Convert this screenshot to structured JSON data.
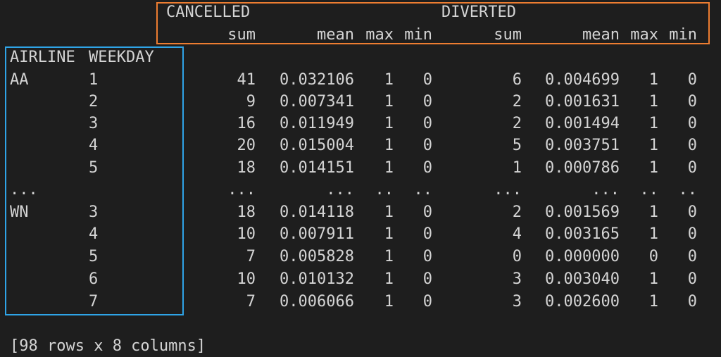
{
  "header": {
    "group_cancelled": "CANCELLED",
    "group_diverted": "DIVERTED",
    "columns": [
      "sum",
      "mean",
      "max",
      "min",
      "sum",
      "mean",
      "max",
      "min"
    ]
  },
  "index": {
    "names": [
      "AIRLINE",
      "WEEKDAY"
    ]
  },
  "rows": [
    [
      "AA",
      "1",
      "41",
      "0.032106",
      "1",
      "0",
      "6",
      "0.004699",
      "1",
      "0"
    ],
    [
      "",
      "2",
      "9",
      "0.007341",
      "1",
      "0",
      "2",
      "0.001631",
      "1",
      "0"
    ],
    [
      "",
      "3",
      "16",
      "0.011949",
      "1",
      "0",
      "2",
      "0.001494",
      "1",
      "0"
    ],
    [
      "",
      "4",
      "20",
      "0.015004",
      "1",
      "0",
      "5",
      "0.003751",
      "1",
      "0"
    ],
    [
      "",
      "5",
      "18",
      "0.014151",
      "1",
      "0",
      "1",
      "0.000786",
      "1",
      "0"
    ],
    [
      "...",
      "",
      "...",
      "...",
      "..",
      "..",
      "...",
      "...",
      "..",
      ".."
    ],
    [
      "WN",
      "3",
      "18",
      "0.014118",
      "1",
      "0",
      "2",
      "0.001569",
      "1",
      "0"
    ],
    [
      "",
      "4",
      "10",
      "0.007911",
      "1",
      "0",
      "4",
      "0.003165",
      "1",
      "0"
    ],
    [
      "",
      "5",
      "7",
      "0.005828",
      "1",
      "0",
      "0",
      "0.000000",
      "0",
      "0"
    ],
    [
      "",
      "6",
      "10",
      "0.010132",
      "1",
      "0",
      "3",
      "0.003040",
      "1",
      "0"
    ],
    [
      "",
      "7",
      "7",
      "0.006066",
      "1",
      "0",
      "3",
      "0.002600",
      "1",
      "0"
    ]
  ],
  "footer": "[98 rows x 8 columns]",
  "colors": {
    "background": "#1e1e1e",
    "text": "#d4d4d4",
    "highlight_column_headers": "#ed7d31",
    "highlight_row_index": "#2fa4e7"
  }
}
